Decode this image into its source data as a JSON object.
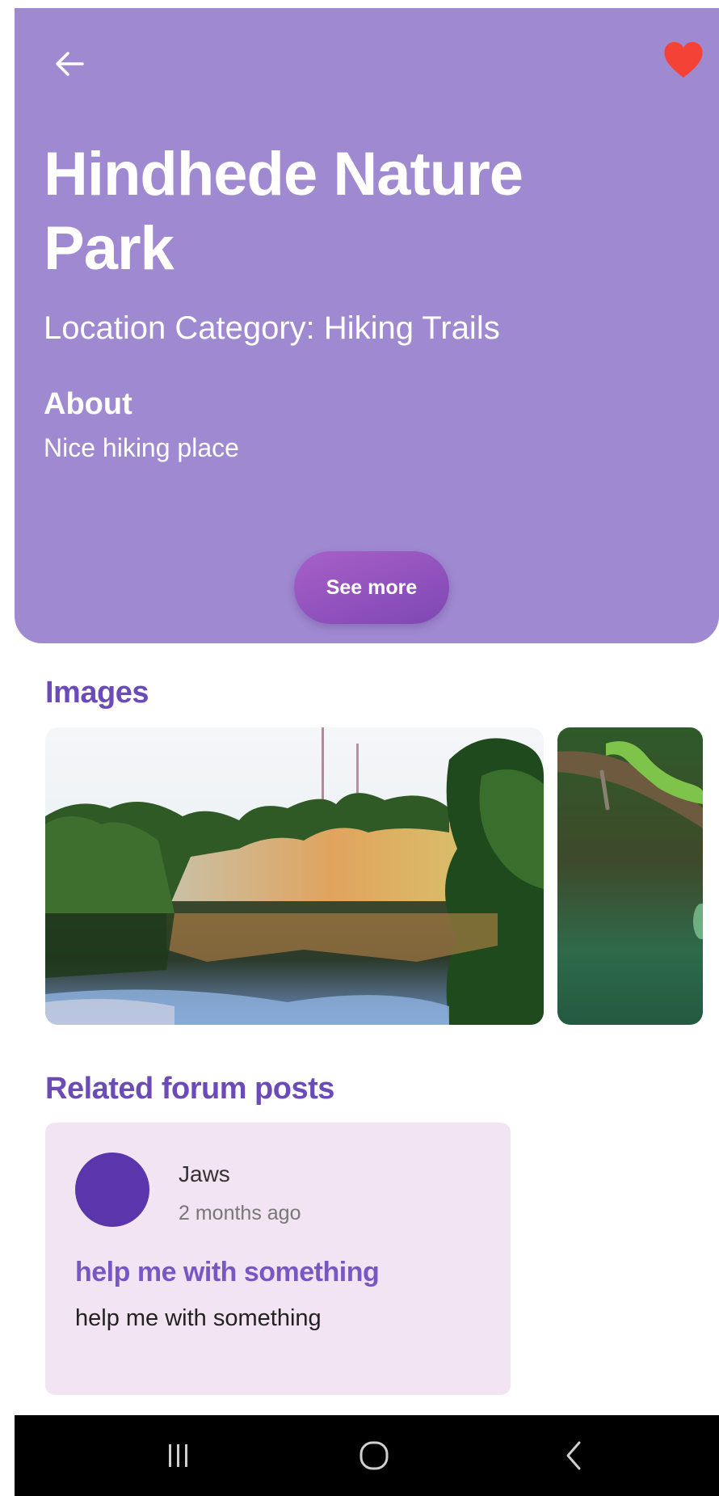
{
  "header": {
    "title": "Hindhede Nature Park",
    "category": "Location Category: Hiking Trails",
    "about_heading": "About",
    "about_text": "Nice hiking place",
    "see_more_label": "See more",
    "back_icon": "arrow-left-icon",
    "favorite_icon": "heart-icon",
    "favorited": true
  },
  "images": {
    "heading": "Images",
    "items": [
      {
        "icon": "quarry-lake-photo"
      },
      {
        "icon": "green-snake-photo"
      }
    ]
  },
  "forum": {
    "heading": "Related forum posts",
    "posts": [
      {
        "author": "Jaws",
        "time": "2 months ago",
        "title": "help me with something",
        "body": "help me with something"
      }
    ]
  },
  "nav_bar": {
    "recents_icon": "recents-icon",
    "home_icon": "home-icon",
    "back_icon": "back-chevron-icon"
  },
  "colors": {
    "hero_background": "#9f89d1",
    "accent": "#6a4bb7",
    "favorite": "#f44336",
    "card_background": "#f3e4f4",
    "avatar": "#5a35ab"
  }
}
